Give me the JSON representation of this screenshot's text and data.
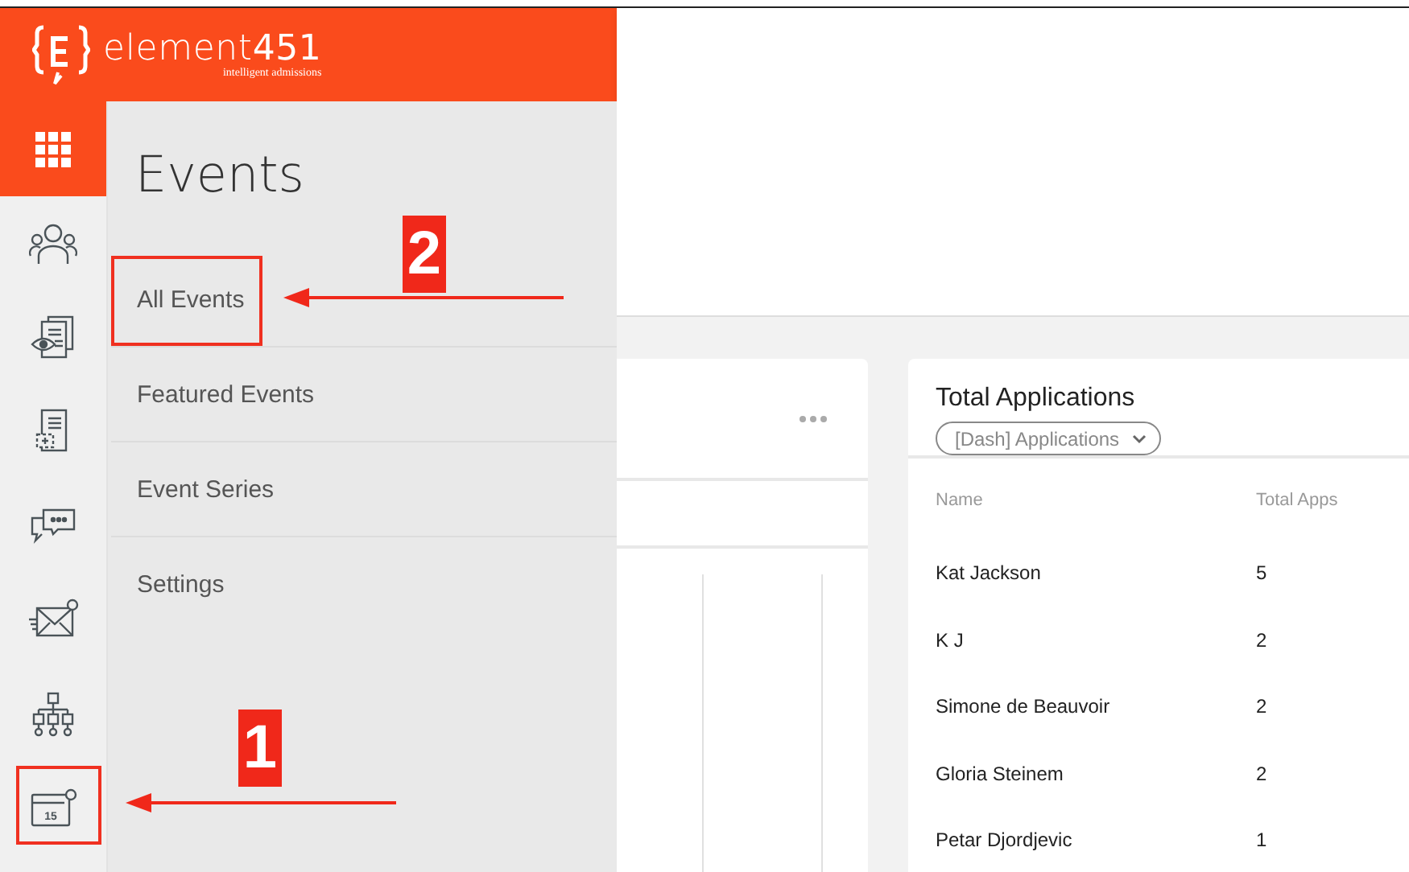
{
  "logo": {
    "wordmark": "element**451**",
    "tagline": "intelligent admissions"
  },
  "rail": [
    {
      "kind": "people"
    },
    {
      "kind": "document-eye"
    },
    {
      "kind": "document-plus"
    },
    {
      "kind": "chat"
    },
    {
      "kind": "envelope"
    },
    {
      "kind": "org-chart"
    },
    {
      "kind": "calendar",
      "day": "15"
    }
  ],
  "flyout": {
    "title": "Events",
    "items": [
      {
        "label": "All Events"
      },
      {
        "label": "Featured Events"
      },
      {
        "label": "Event Series"
      },
      {
        "label": "Settings"
      }
    ]
  },
  "applications_card": {
    "title": "Total Applications",
    "dropdown": "[Dash] Applications",
    "columns": [
      "Name",
      "Total Apps"
    ],
    "rows": [
      [
        "Kat Jackson",
        "5"
      ],
      [
        "K J",
        "2"
      ],
      [
        "Simone de Beauvoir",
        "2"
      ],
      [
        "Gloria Steinem",
        "2"
      ],
      [
        "Petar Djordjevic",
        "1"
      ]
    ]
  },
  "annotations": [
    {
      "label": "1"
    },
    {
      "label": "2"
    }
  ]
}
